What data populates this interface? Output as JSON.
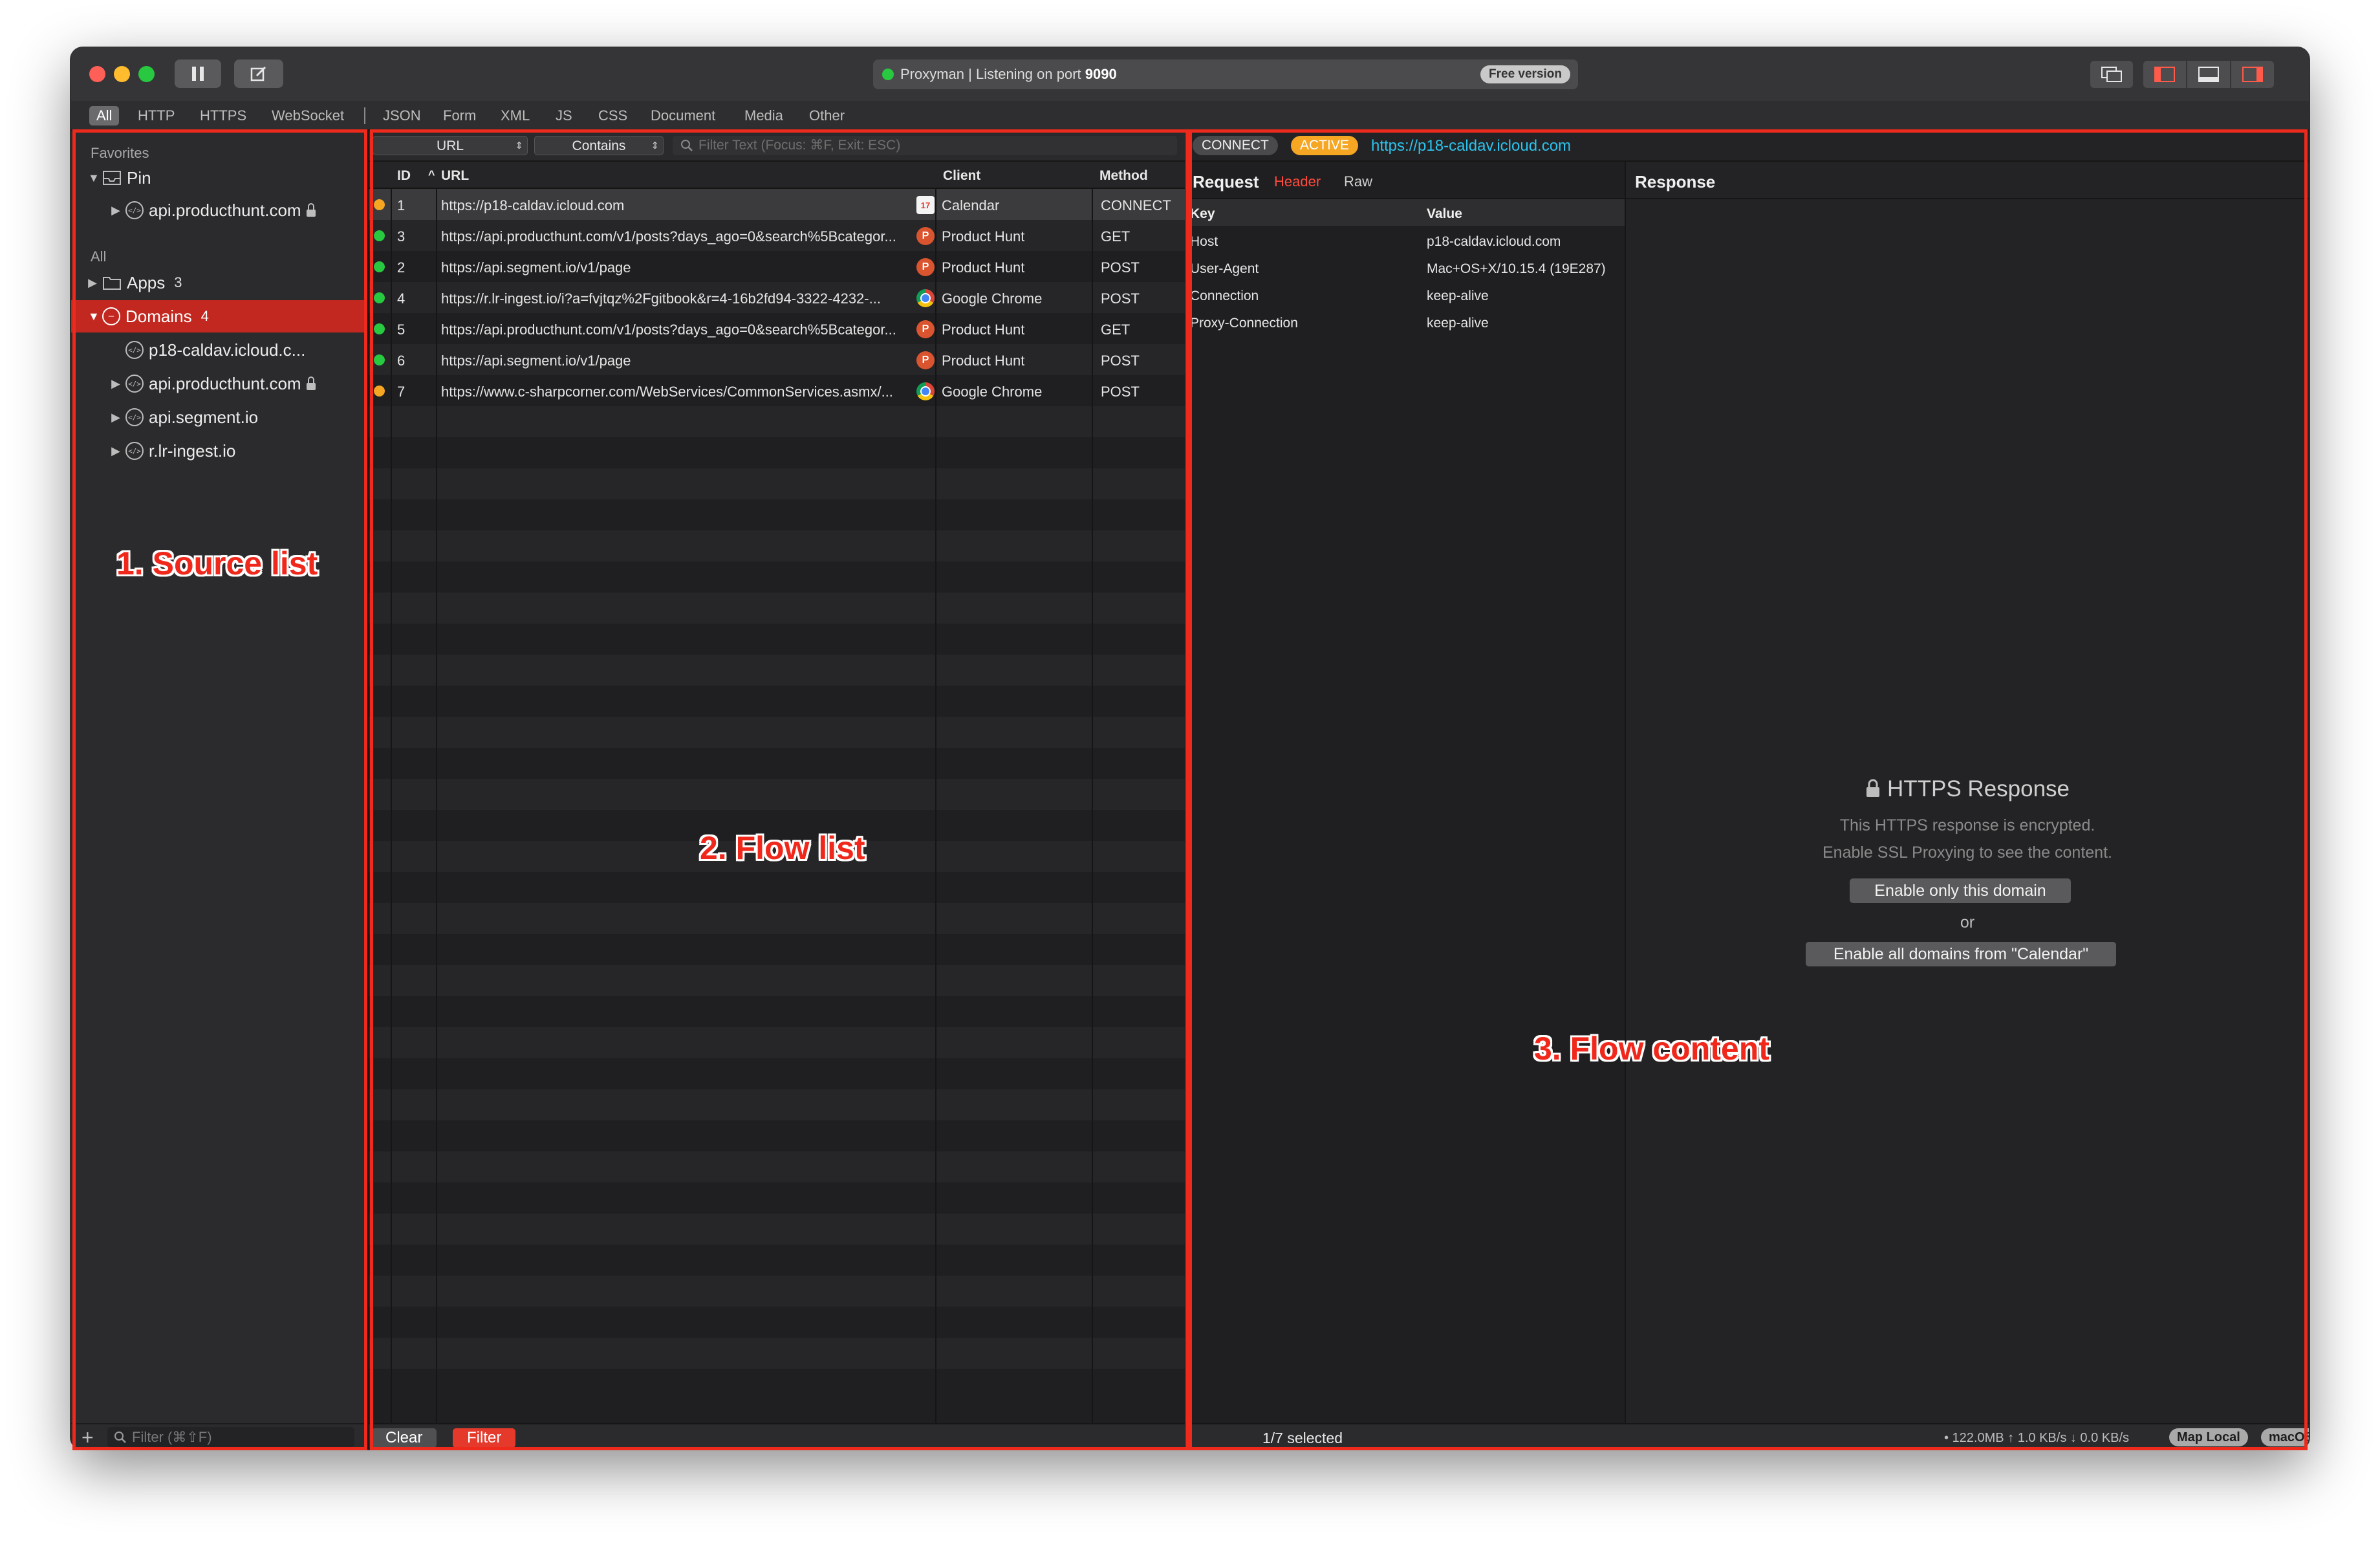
{
  "titlebar": {
    "status_text": "Proxyman | Listening on port",
    "port": "9090",
    "free_badge": "Free version",
    "pause_icon": "pause-icon",
    "compose_icon": "compose-icon"
  },
  "filter_tabs": [
    "All",
    "HTTP",
    "HTTPS",
    "WebSocket",
    "JSON",
    "Form",
    "XML",
    "JS",
    "CSS",
    "Document",
    "Media",
    "Other"
  ],
  "sidebar": {
    "favorites_label": "Favorites",
    "pin_label": "Pin",
    "pin_child": "api.producthunt.com",
    "all_label": "All",
    "apps_label": "Apps",
    "apps_count": "3",
    "domains_label": "Domains",
    "domains_count": "4",
    "domains": [
      "p18-caldav.icloud.c...",
      "api.producthunt.com",
      "api.segment.io",
      "r.lr-ingest.io"
    ],
    "filter_placeholder": "Filter (⌘⇧F)",
    "add_label": "+"
  },
  "flow_list": {
    "field_select": "URL",
    "match_select": "Contains",
    "filter_placeholder": "Filter Text (Focus: ⌘F, Exit: ESC)",
    "columns": {
      "id": "ID",
      "sort_indicator": "^",
      "url": "URL",
      "client": "Client",
      "method": "Method"
    },
    "rows": [
      {
        "status": "orange",
        "id": "1",
        "url": "https://p18-caldav.icloud.com",
        "client": "Calendar",
        "client_icon": "calendar-icon",
        "method": "CONNECT"
      },
      {
        "status": "green",
        "id": "3",
        "url": "https://api.producthunt.com/v1/posts?days_ago=0&search%5Bcategor...",
        "client": "Product Hunt",
        "client_icon": "producthunt-icon",
        "method": "GET"
      },
      {
        "status": "green",
        "id": "2",
        "url": "https://api.segment.io/v1/page",
        "client": "Product Hunt",
        "client_icon": "producthunt-icon",
        "method": "POST"
      },
      {
        "status": "green",
        "id": "4",
        "url": "https://r.lr-ingest.io/i?a=fvjtqz%2Fgitbook&r=4-16b2fd94-3322-4232-...",
        "client": "Google Chrome",
        "client_icon": "chrome-icon",
        "method": "POST"
      },
      {
        "status": "green",
        "id": "5",
        "url": "https://api.producthunt.com/v1/posts?days_ago=0&search%5Bcategor...",
        "client": "Product Hunt",
        "client_icon": "producthunt-icon",
        "method": "GET"
      },
      {
        "status": "green",
        "id": "6",
        "url": "https://api.segment.io/v1/page",
        "client": "Product Hunt",
        "client_icon": "producthunt-icon",
        "method": "POST"
      },
      {
        "status": "orange",
        "id": "7",
        "url": "https://www.c-sharpcorner.com/WebServices/CommonServices.asmx/...",
        "client": "Google Chrome",
        "client_icon": "chrome-icon",
        "method": "POST"
      }
    ],
    "clear_button": "Clear",
    "filter_button": "Filter"
  },
  "detail": {
    "method_badge": "CONNECT",
    "state_badge": "ACTIVE",
    "url": "https://p18-caldav.icloud.com",
    "request_title": "Request",
    "request_tabs": [
      "Header",
      "Raw"
    ],
    "response_title": "Response",
    "kv_headers": {
      "key": "Key",
      "value": "Value"
    },
    "headers": [
      {
        "key": "Host",
        "value": "p18-caldav.icloud.com"
      },
      {
        "key": "User-Agent",
        "value": "Mac+OS+X/10.15.4 (19E287)"
      },
      {
        "key": "Connection",
        "value": "keep-alive"
      },
      {
        "key": "Proxy-Connection",
        "value": "keep-alive"
      }
    ],
    "encrypted_title": "HTTPS Response",
    "encrypted_line1": "This HTTPS response is encrypted.",
    "encrypted_line2": "Enable SSL Proxying to see the content.",
    "enable_domain_button": "Enable only this domain",
    "or_text": "or",
    "enable_all_button": "Enable all domains from \"Calendar\""
  },
  "footer": {
    "selected_text": "1/7 selected",
    "stats": "• 122.0MB ↑ 1.0 KB/s ↓ 0.0 KB/s",
    "map_local": "Map Local",
    "macos_proxy": "macOS Proxy"
  },
  "annotations": {
    "source_list": "1. Source list",
    "flow_list": "2. Flow list",
    "flow_content": "3. Flow content"
  },
  "colors": {
    "accent_red": "#ee2a1c",
    "selection_red": "#c22820",
    "status_green": "#28c840",
    "status_orange": "#f5a623",
    "link_blue": "#2cc3ee",
    "active_badge": "#f5a623"
  }
}
